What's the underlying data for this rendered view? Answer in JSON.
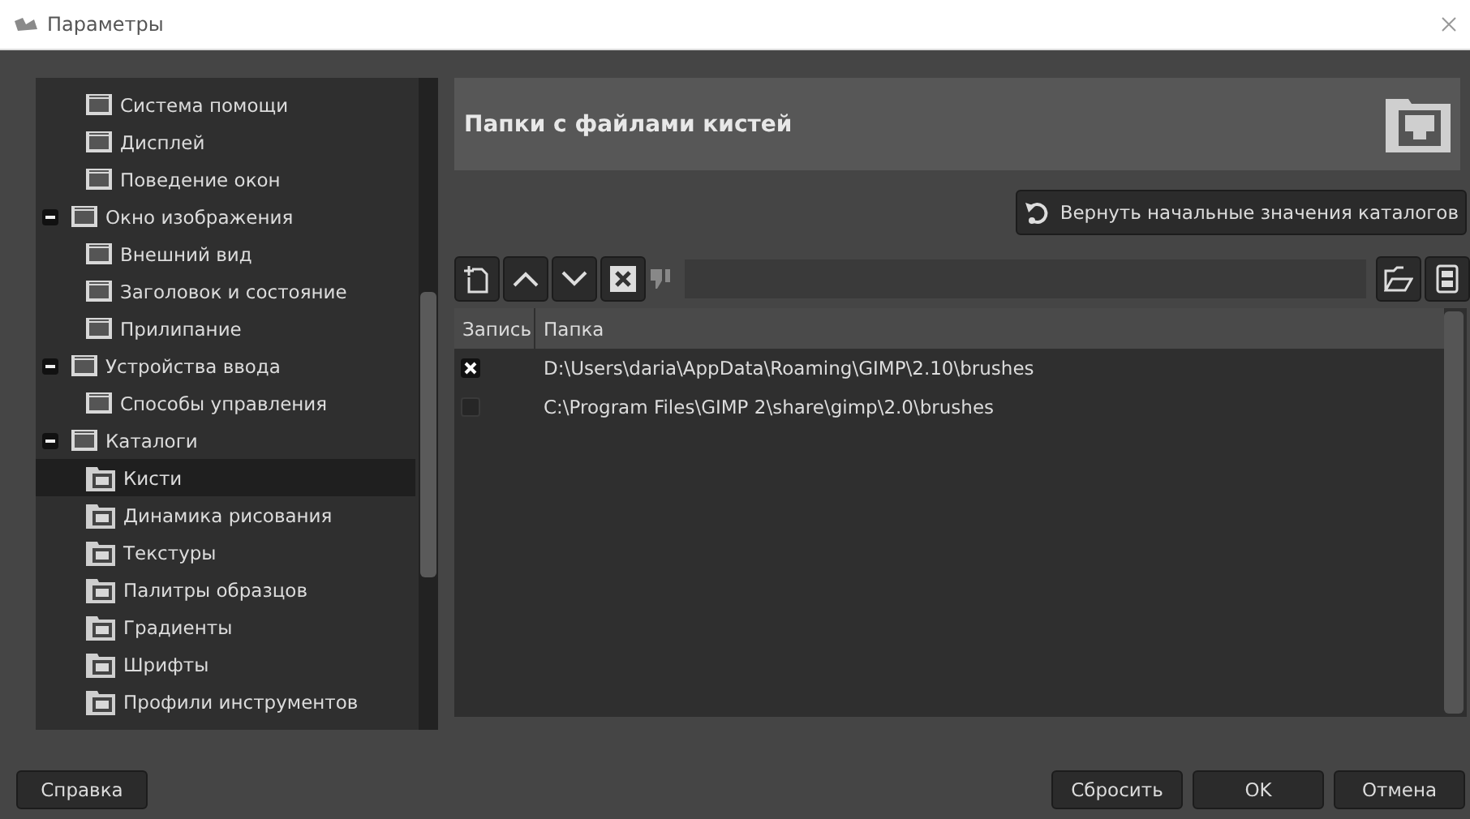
{
  "window": {
    "title": "Параметры"
  },
  "sidebar": {
    "items": [
      {
        "children": [
          {
            "label": "Система помощи",
            "selected": false
          },
          {
            "label": "Дисплей",
            "selected": false
          },
          {
            "label": "Поведение окон",
            "selected": false
          }
        ]
      },
      {
        "label": "Окно изображения",
        "selected": false,
        "expanded": true,
        "children": [
          {
            "label": "Внешний вид",
            "selected": false
          },
          {
            "label": "Заголовок и состояние",
            "selected": false
          },
          {
            "label": "Прилипание",
            "selected": false
          }
        ]
      },
      {
        "label": "Устройства ввода",
        "selected": false,
        "expanded": true,
        "children": [
          {
            "label": "Способы управления",
            "selected": false
          }
        ]
      },
      {
        "label": "Каталоги",
        "selected": false,
        "expanded": true,
        "children": [
          {
            "label": "Кисти",
            "selected": true
          },
          {
            "label": "Динамика рисования",
            "selected": false
          },
          {
            "label": "Текстуры",
            "selected": false
          },
          {
            "label": "Палитры образцов",
            "selected": false
          },
          {
            "label": "Градиенты",
            "selected": false
          },
          {
            "label": "Шрифты",
            "selected": false
          },
          {
            "label": "Профили инструментов",
            "selected": false
          }
        ]
      }
    ]
  },
  "page": {
    "title": "Папки с файлами кистей",
    "reset_button": "Вернуть начальные значения каталогов"
  },
  "table": {
    "columns": [
      "Запись",
      "Папка"
    ],
    "rows": [
      {
        "checked": true,
        "path": "D:\\Users\\daria\\AppData\\Roaming\\GIMP\\2.10\\brushes"
      },
      {
        "checked": false,
        "path": "C:\\Program Files\\GIMP 2\\share\\gimp\\2.0\\brushes"
      }
    ]
  },
  "buttons": {
    "help": "Справка",
    "reset": "Сбросить",
    "ok": "OK",
    "cancel": "Отмена"
  }
}
